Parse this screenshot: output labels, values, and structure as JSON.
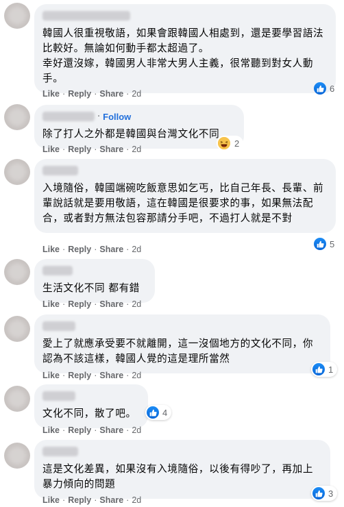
{
  "colors": {
    "like_blue": "#1877f2",
    "follow_blue": "#216fdb",
    "bubble_bg": "#f0f2f5",
    "meta_gray": "#65676b"
  },
  "actions": {
    "like": "Like",
    "reply": "Reply",
    "share": "Share",
    "dot": "·"
  },
  "comments": [
    {
      "text": "韓國人很重視敬語，如果會跟韓國人相處到，還是要學習語法比較好。無論如何動手都太超過了。\n幸好還沒嫁，韓國男人非常大男人主義，很常聽到對女人動手。",
      "time": "2d",
      "reaction_icon": "like-icon",
      "reaction_count": "6"
    },
    {
      "text": "除了打人之外都是韓國與台灣文化不同",
      "follow": "Follow",
      "time": "2d",
      "reaction_icon": "haha-icon",
      "reaction_count": "2"
    },
    {
      "text": "入境隨俗，韓國端碗吃飯意思如乞丐，比自己年長、長輩、前輩說話就是要用敬語，這在韓國是很要求的事，如果無法配合，或者對方無法包容那請分手吧，不過打人就是不對",
      "time": "2d",
      "reaction_icon": "like-icon",
      "reaction_count": "5"
    },
    {
      "text": "生活文化不同 都有錯",
      "time": "2d"
    },
    {
      "text": "愛上了就應承受要不就離開，這一沒個地方的文化不同，你認為不該這樣，韓國人覺的這是理所當然",
      "time": "2d",
      "reaction_icon": "like-icon",
      "reaction_count": "1"
    },
    {
      "text": "文化不同，散了吧。",
      "time": "2d",
      "reaction_icon": "like-icon",
      "reaction_count": "4"
    },
    {
      "text": "這是文化差異，如果沒有入境隨俗，以後有得吵了，再加上暴力傾向的問題",
      "time": "2d",
      "reaction_icon": "like-icon",
      "reaction_count": "3"
    }
  ]
}
